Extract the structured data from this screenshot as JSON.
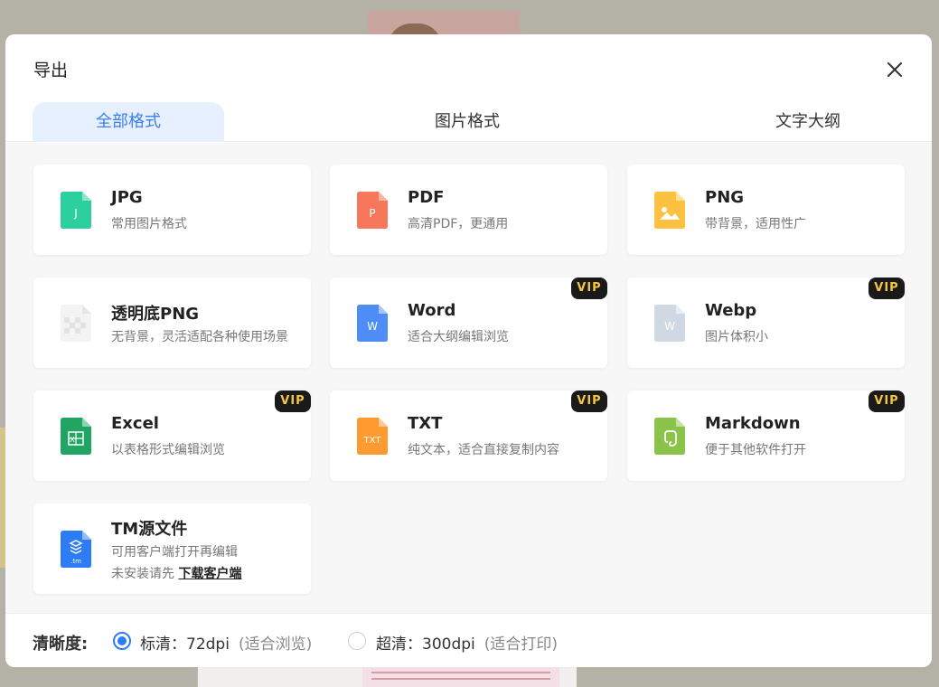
{
  "dialog": {
    "title": "导出",
    "close_icon": "close-icon"
  },
  "tabs": [
    {
      "label": "全部格式",
      "active": true
    },
    {
      "label": "图片格式",
      "active": false
    },
    {
      "label": "文字大纲",
      "active": false
    }
  ],
  "formats": [
    {
      "name": "JPG",
      "desc": "常用图片格式",
      "icon": "jpg-file-icon",
      "color": "#2ecf9f",
      "glyph": "J",
      "vip": false
    },
    {
      "name": "PDF",
      "desc": "高清PDF，更通用",
      "icon": "pdf-file-icon",
      "color": "#f7775c",
      "glyph": "P",
      "vip": false
    },
    {
      "name": "PNG",
      "desc": "带背景，适用性广",
      "icon": "png-file-icon",
      "color": "#fcc140",
      "glyph": "",
      "vip": false
    },
    {
      "name": "透明底PNG",
      "desc": "无背景，灵活适配各种使用场景",
      "icon": "transparent-png-file-icon",
      "color": "#eeeeee",
      "glyph": "",
      "vip": false
    },
    {
      "name": "Word",
      "desc": "适合大纲编辑浏览",
      "icon": "word-file-icon",
      "color": "#4f8df6",
      "glyph": "W",
      "vip": true
    },
    {
      "name": "Webp",
      "desc": "图片体积小",
      "icon": "webp-file-icon",
      "color": "#cfd8e3",
      "glyph": "W",
      "vip": true
    },
    {
      "name": "Excel",
      "desc": "以表格形式编辑浏览",
      "icon": "excel-file-icon",
      "color": "#21a464",
      "glyph": "X",
      "vip": true
    },
    {
      "name": "TXT",
      "desc": "纯文本，适合直接复制内容",
      "icon": "txt-file-icon",
      "color": "#fd9a30",
      "glyph": "TXT",
      "vip": true
    },
    {
      "name": "Markdown",
      "desc": "便于其他软件打开",
      "icon": "markdown-file-icon",
      "color": "#8bc34a",
      "glyph": "",
      "vip": true
    },
    {
      "name": "TM源文件",
      "desc": "可用客户端打开再编辑",
      "desc2": "未安装请先",
      "link": "下载客户端",
      "icon": "tm-file-icon",
      "color": "#2d7cf6",
      "glyph": ".tm",
      "vip": false
    }
  ],
  "vip_label": "VIP",
  "resolution": {
    "label": "清晰度:",
    "options": [
      {
        "text": "标清：72dpi",
        "note": "(适合浏览)",
        "checked": true
      },
      {
        "text": "超清：300dpi",
        "note": "(适合打印)",
        "checked": false
      }
    ]
  }
}
